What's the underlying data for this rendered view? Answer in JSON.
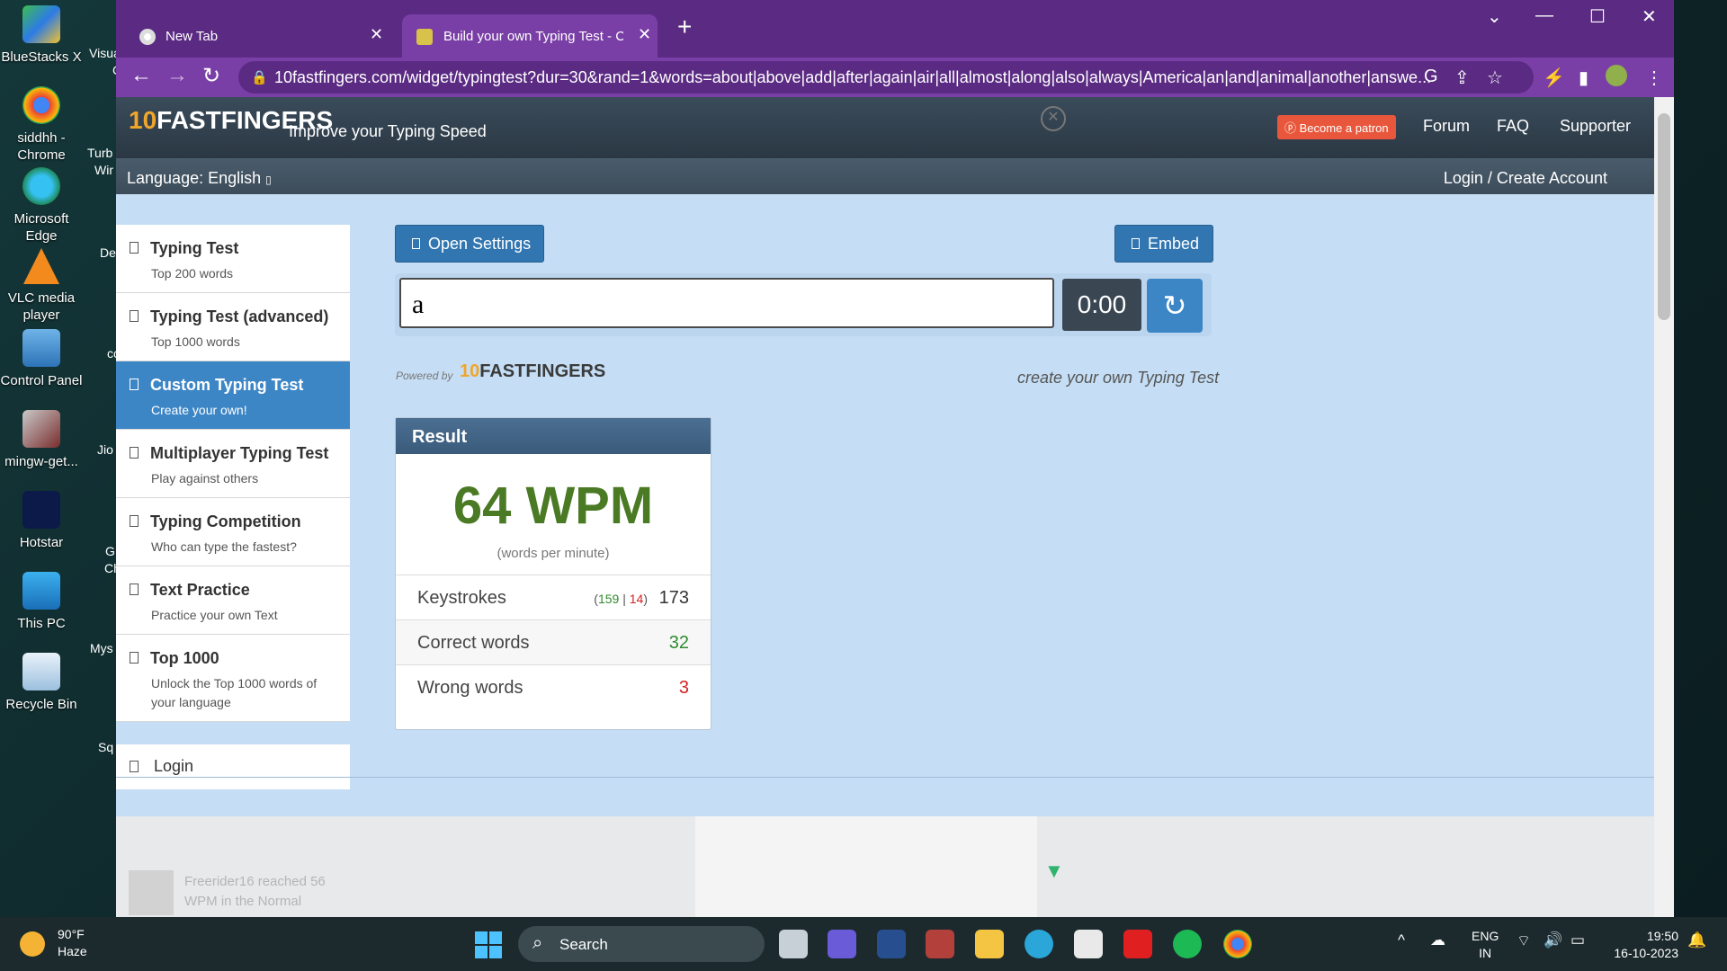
{
  "desktop": {
    "icons": [
      {
        "label": "BlueStacks X"
      },
      {
        "label": "siddhh - Chrome"
      },
      {
        "label": "Microsoft Edge"
      },
      {
        "label": "VLC media player"
      },
      {
        "label": "Control Panel"
      },
      {
        "label": "mingw-get..."
      },
      {
        "label": "Hotstar"
      },
      {
        "label": "This PC"
      },
      {
        "label": "Recycle Bin"
      }
    ],
    "partial": [
      "Visua",
      "C",
      "Turb",
      "Wir",
      "De",
      "cc",
      "Jio",
      "G",
      "Ch",
      "Mys",
      "Sq"
    ]
  },
  "browser": {
    "tabs": [
      {
        "title": "New Tab",
        "close": "✕"
      },
      {
        "title": "Build your own Typing Test - Cus",
        "close": "✕"
      }
    ],
    "new_tab": "+",
    "url": "10fastfingers.com/widget/typingtest?dur=30&rand=1&words=about|above|add|after|again|air|all|almost|along|also|always|America|an|and|animal|another|answe...",
    "colors": {
      "frame": "#5b2b83",
      "toolbar": "#7a3fa6"
    }
  },
  "site": {
    "logo_main": "FASTFINGERS",
    "logo_num": "10",
    "tagline": "Improve your Typing Speed",
    "patron": "Become a patron",
    "nav": {
      "forum": "Forum",
      "faq": "FAQ",
      "supporter": "Supporter"
    },
    "language": "Language: English",
    "login": "Login / Create Account"
  },
  "sidebar": {
    "items": [
      {
        "title": "Typing Test",
        "subtitle": "Top 200 words"
      },
      {
        "title": "Typing Test (advanced)",
        "subtitle": "Top 1000 words"
      },
      {
        "title": "Custom Typing Test",
        "subtitle": "Create your own!"
      },
      {
        "title": "Multiplayer Typing Test",
        "subtitle": "Play against others"
      },
      {
        "title": "Typing Competition",
        "subtitle": "Who can type the fastest?"
      },
      {
        "title": "Text Practice",
        "subtitle": "Practice your own Text"
      },
      {
        "title": "Top 1000",
        "subtitle": "Unlock the Top 1000 words of your language"
      }
    ],
    "login": "Login"
  },
  "main": {
    "open_settings": "Open Settings",
    "embed": "Embed",
    "input_value": "a",
    "timer": "0:00",
    "reload": "↻",
    "powered_by": "Powered by",
    "powered_logo": "FASTFINGERS",
    "create_own": "create your own Typing Test"
  },
  "result": {
    "header": "Result",
    "wpm": "64 WPM",
    "wpm_sub": "(words per minute)",
    "keystrokes_label": "Keystrokes",
    "keystrokes_correct": "159",
    "keystrokes_wrong": "14",
    "keystrokes_total": "173",
    "correct_label": "Correct words",
    "correct_value": "32",
    "wrong_label": "Wrong words",
    "wrong_value": "3",
    "colors": {
      "wpm": "#4b7a25",
      "correct": "#2f8a2f",
      "wrong": "#d42020"
    }
  },
  "feed": {
    "text": "Freerider16 reached 56 WPM in the Normal"
  },
  "taskbar": {
    "weather_temp": "90°F",
    "weather_desc": "Haze",
    "search": "Search",
    "lang_line1": "ENG",
    "lang_line2": "IN",
    "time": "19:50",
    "date": "16-10-2023"
  }
}
